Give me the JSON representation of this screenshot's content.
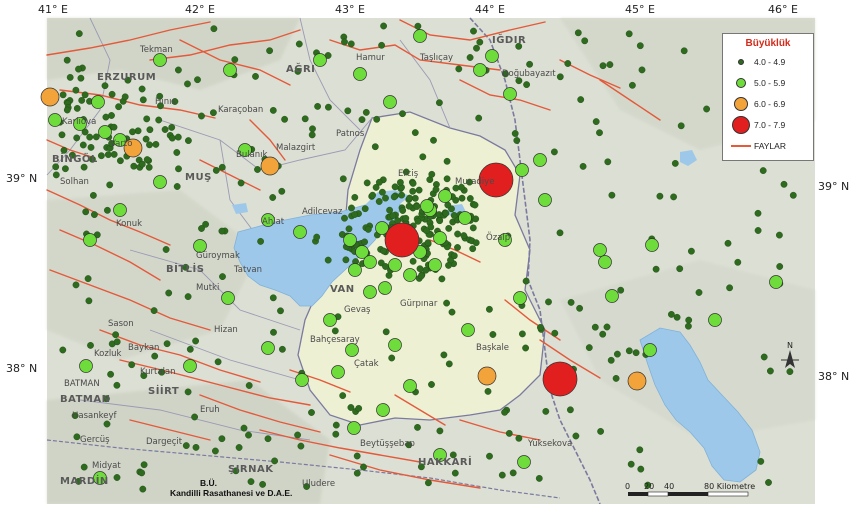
{
  "map": {
    "longitude_labels": [
      "41° E",
      "42° E",
      "43° E",
      "44° E",
      "45° E",
      "46° E"
    ],
    "latitude_labels_left": [
      "39° N",
      "38° N"
    ],
    "latitude_labels_right": [
      "39° N",
      "38° N"
    ],
    "places": {
      "erzurum": "ERZURUM",
      "bingol": "BİNGÖL",
      "mus": "MUŞ",
      "bitlis": "BİTLİS",
      "van": "VAN",
      "agri": "AĞRI",
      "igdir": "IĞDIR",
      "siirt": "SİİRT",
      "batman_region": "BATMAN",
      "mardin": "MARDİN",
      "sirnak": "ŞIRNAK",
      "hakkari": "HAKKARİ",
      "tekman": "Tekman",
      "hinis": "Hınıs",
      "karacoban": "Karaçoban",
      "patnos": "Patnos",
      "malazgirt": "Malazgirt",
      "bulanik": "Bulanık",
      "ercis": "Erciş",
      "muradiye": "Muradiye",
      "adilcevaz": "Adilcevaz",
      "ahlat": "Ahlat",
      "tatvan": "Tatvan",
      "guroymak": "Güroymak",
      "mutki": "Mutki",
      "hizan": "Hizan",
      "gevas": "Gevaş",
      "gurpinar": "Gürpınar",
      "bahcesaray": "Bahçesaray",
      "catak": "Çatak",
      "ozalp": "Özalp",
      "baskale": "Başkale",
      "yuksekova": "Yüksekova",
      "beytussebap": "Beytüşşebap",
      "kurtalan": "Kurtalan",
      "batman_city": "BATMAN",
      "hasankeyf": "Hasankeyf",
      "gercus": "Gercüş",
      "midyat": "Midyat",
      "dargecit": "Dargeçit",
      "eruh": "Eruh",
      "uludere": "Uludere",
      "doğubayazit": "Doğubayazıt",
      "tasliçay": "Taşlıçay",
      "hamur": "Hamur",
      "baykan": "Baykan",
      "kozluk": "Kozluk",
      "sason": "Sason",
      "varto": "Varto",
      "karliova": "Karlıova",
      "solhan": "Solhan",
      "konuk": "Konuk"
    }
  },
  "legend": {
    "title": "Büyüklük",
    "items": [
      {
        "label": "4.0 - 4.9",
        "color": "#2e6b1e",
        "magnitude_class": "4"
      },
      {
        "label": "5.0 - 5.9",
        "color": "#6edc3a",
        "magnitude_class": "5"
      },
      {
        "label": "6.0 - 6.9",
        "color": "#f2a33a",
        "magnitude_class": "6"
      },
      {
        "label": "7.0 - 7.9",
        "color": "#e21f1f",
        "magnitude_class": "7"
      }
    ],
    "fault_label": "FAYLAR",
    "fault_color": "#e45a3a"
  },
  "scale": {
    "ticks": [
      "0",
      "20",
      "40",
      "80 Kilometre"
    ]
  },
  "north_arrow": "N",
  "credit": {
    "line1": "B.Ü.",
    "line2": "Kandilli Rasathanesi ve D.A.E."
  },
  "colors": {
    "land": "#dfe3d6",
    "lake": "#9ec8ea",
    "province_highlight": "#eef0d3",
    "border": "#7a7aa0"
  }
}
